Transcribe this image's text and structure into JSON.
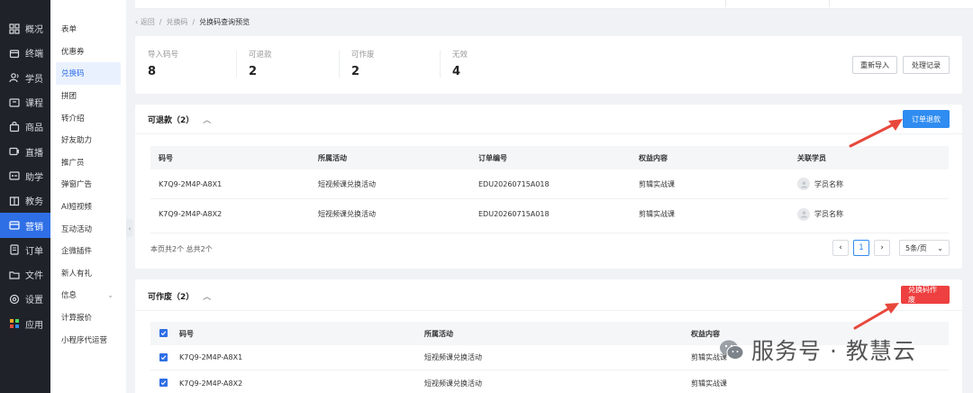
{
  "nav": {
    "items": [
      {
        "label": "概况",
        "icon": "grid-icon"
      },
      {
        "label": "终端",
        "icon": "store-icon"
      },
      {
        "label": "学员",
        "icon": "users-icon"
      },
      {
        "label": "课程",
        "icon": "course-icon"
      },
      {
        "label": "商品",
        "icon": "goods-icon"
      },
      {
        "label": "直播",
        "icon": "live-icon"
      },
      {
        "label": "助学",
        "icon": "study-icon"
      },
      {
        "label": "教务",
        "icon": "book-icon"
      },
      {
        "label": "营销",
        "icon": "marketing-icon"
      },
      {
        "label": "订单",
        "icon": "order-icon"
      },
      {
        "label": "文件",
        "icon": "folder-icon"
      },
      {
        "label": "设置",
        "icon": "gear-icon"
      },
      {
        "label": "应用",
        "icon": "apps-icon"
      }
    ],
    "active_index": 8
  },
  "submenu": {
    "items": [
      "表单",
      "优惠券",
      "兑换码",
      "拼团",
      "转介绍",
      "好友助力",
      "推广员",
      "弹窗广告",
      "AI短视频",
      "互动活动",
      "企微插件",
      "新人有礼",
      "信息",
      "计算报价",
      "小程序代运营"
    ],
    "active_index": 2,
    "expandable_index": 12
  },
  "breadcrumb": {
    "back": "‹ 返回",
    "level1": "兑换码",
    "current": "兑换码查询预览",
    "sep": "/"
  },
  "stats": [
    {
      "label": "导入码号",
      "value": "8"
    },
    {
      "label": "可退款",
      "value": "2"
    },
    {
      "label": "可作废",
      "value": "2"
    },
    {
      "label": "无效",
      "value": "4"
    }
  ],
  "actions": {
    "reimport": "重新导入",
    "records": "处理记录"
  },
  "refundable": {
    "title": "可退款（2）",
    "action": "订单退款",
    "columns": [
      "码号",
      "所属活动",
      "订单编号",
      "权益内容",
      "关联学员"
    ],
    "rows": [
      [
        "K7Q9-2M4P-A8X1",
        "短视频课兑换活动",
        "EDU20260715A018",
        "剪辑实战课",
        "学员名称"
      ],
      [
        "K7Q9-2M4P-A8X2",
        "短视频课兑换活动",
        "EDU20260715A018",
        "剪辑实战课",
        "学员名称"
      ]
    ],
    "pager": {
      "total": "本页共2个  总共2个",
      "prev": "‹",
      "page": "1",
      "next": "›",
      "size": "5条/页",
      "size_caret": "⌄"
    }
  },
  "voidable": {
    "title": "可作废（2）",
    "action": "兑换码作废",
    "columns": [
      "码号",
      "所属活动",
      "权益内容"
    ],
    "rows": [
      [
        "K7Q9-2M4P-A8X1",
        "短视频课兑换活动",
        "剪辑实战课"
      ],
      [
        "K7Q9-2M4P-A8X2",
        "短视频课兑换活动",
        "剪辑实战课"
      ]
    ]
  },
  "watermark": "服务号 · 教慧云",
  "colors": {
    "primary": "#2f8cf0",
    "danger": "#ee4040",
    "nav_bg": "#1f2329",
    "nav_active": "#2f6fe6",
    "arrow": "#e8483c"
  }
}
